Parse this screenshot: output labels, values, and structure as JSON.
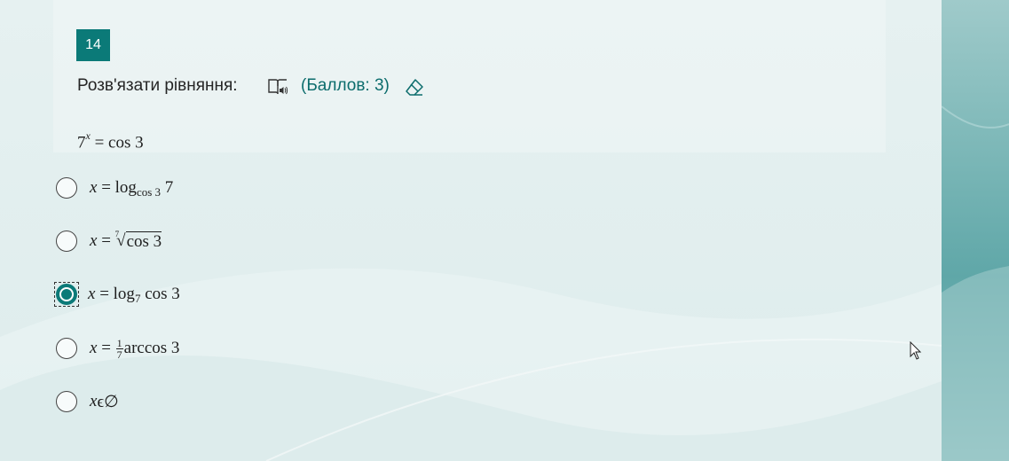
{
  "question": {
    "number": "14",
    "title": "Розв'язати рівняння:",
    "points": "(Баллов: 3)",
    "icons": [
      "immersive-reader-icon",
      "eraser-icon"
    ],
    "equation": {
      "base": "7",
      "exponent": "x",
      "rhs": "= cos 3"
    }
  },
  "options": [
    {
      "var": "x",
      "eq": "=",
      "func": "log",
      "sub": "cos 3",
      "arg": "7",
      "selected": false
    },
    {
      "var": "x",
      "eq": "=",
      "root_index": "7",
      "radicand": "cos 3",
      "selected": false
    },
    {
      "var": "x",
      "eq": "=",
      "func": "log",
      "sub": "7",
      "arg": "cos 3",
      "selected": true
    },
    {
      "var": "x",
      "eq": "=",
      "frac_num": "1",
      "frac_den": "7",
      "rest": "arccos 3",
      "selected": false
    },
    {
      "var": "x",
      "symbol": "ϵ∅",
      "selected": false
    }
  ],
  "colors": {
    "accent": "#0b7a78",
    "points_text": "#0b6c6c"
  }
}
